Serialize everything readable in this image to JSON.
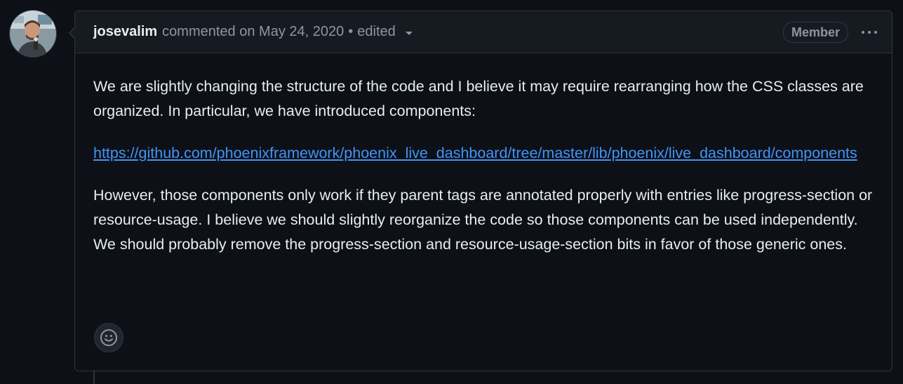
{
  "comment": {
    "author": "josevalim",
    "action": "commented on",
    "date": "May 24, 2020",
    "separator": "•",
    "edited": "edited",
    "badge": "Member",
    "avatar_icon": "user-avatar",
    "paragraphs": [
      "We are slightly changing the structure of the code and I believe it may require rearranging how the CSS classes are organized. In particular, we have introduced components:",
      "However, those components only work if they parent tags are annotated properly with entries like progress-section or resource-usage. I believe we should slightly reorganize the code so those components can be used independently. We should probably remove the progress-section and resource-usage-section bits in favor of those generic ones."
    ],
    "link": "https://github.com/phoenixframework/phoenix_live_dashboard/tree/master/lib/phoenix/live_dashboard/components",
    "reaction_icon": "smiley-icon",
    "menu_icon": "kebab-horizontal-icon"
  },
  "colors": {
    "background": "#0d1117",
    "header": "#161b22",
    "border": "#30363d",
    "text": "#e6edf3",
    "muted": "#8d96a0",
    "link": "#4493f8"
  }
}
